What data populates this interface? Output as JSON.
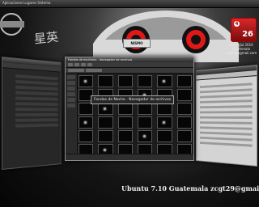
{
  "top_panel": {
    "menu_text": "Aplicaciones  Lugares  Sistema",
    "clock": ""
  },
  "car": {
    "plate": "NISMO"
  },
  "calendar": {
    "day": "26"
  },
  "widget": {
    "lines": [
      "Lunes/Jul 2010",
      "Guatemala",
      "zcgt29@gmail.com"
    ]
  },
  "main_window": {
    "title": "Fondos de escritorio - Navegador de archivos",
    "tooltip": "Fondos de Noche - Navegador de archivos",
    "thumbs_lit": [
      0,
      4,
      9,
      13,
      18,
      22,
      27,
      31,
      36
    ]
  },
  "caption": "Ubuntu 7.10  Guatemala  zcgt29@gmail.com",
  "colors": {
    "calendar_red": "#d8282a",
    "window_bg": "#1c1c1c"
  }
}
